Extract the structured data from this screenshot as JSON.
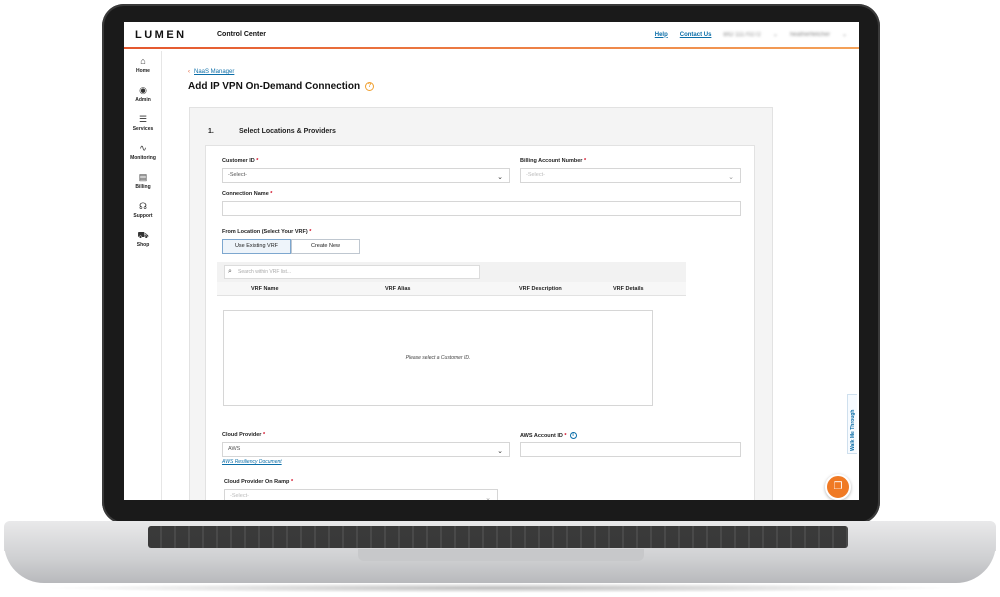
{
  "header": {
    "logo": "LUMEN",
    "app_title": "Control Center",
    "help": "Help",
    "contact": "Contact Us",
    "account_blurred": "BID 11170272",
    "user_blurred": "heatherfletcher"
  },
  "sidebar": {
    "items": [
      {
        "label": "Home",
        "icon": "⌂"
      },
      {
        "label": "Admin",
        "icon": "◉"
      },
      {
        "label": "Services",
        "icon": "☰"
      },
      {
        "label": "Monitoring",
        "icon": "∿"
      },
      {
        "label": "Billing",
        "icon": "▤"
      },
      {
        "label": "Support",
        "icon": "☊"
      },
      {
        "label": "Shop",
        "icon": "⛟"
      }
    ]
  },
  "page": {
    "breadcrumb": "NaaS Manager",
    "title": "Add IP VPN On-Demand Connection"
  },
  "step": {
    "number": "1.",
    "title": "Select Locations & Providers"
  },
  "form": {
    "customer_id_label": "Customer ID",
    "customer_id_value": "-Select-",
    "billing_label": "Billing Account Number",
    "billing_value": "-Select-",
    "connection_name_label": "Connection Name",
    "from_location_label": "From Location (Select Your VRF)",
    "use_existing": "Use Existing VRF",
    "create_new": "Create New",
    "search_placeholder": "Search within VRF list...",
    "vrf_columns": [
      "VRF Name",
      "VRF Alias",
      "VRF Description",
      "VRF Details"
    ],
    "vrf_empty": "Please select a Customer ID.",
    "cloud_provider_label": "Cloud Provider",
    "cloud_provider_value": "AWS",
    "aws_doc_link": "AWS Resiliency Document",
    "aws_account_label": "AWS Account ID",
    "onramp_label": "Cloud Provider On Ramp",
    "onramp_value": "-Select-",
    "required_mark": "*"
  },
  "widgets": {
    "walk_me": "Walk Me Through",
    "chat_icon": "chat-icon"
  },
  "colors": {
    "accent_orange": "#f07a24",
    "link_blue": "#0b6ea8",
    "required_red": "#d0021b"
  }
}
